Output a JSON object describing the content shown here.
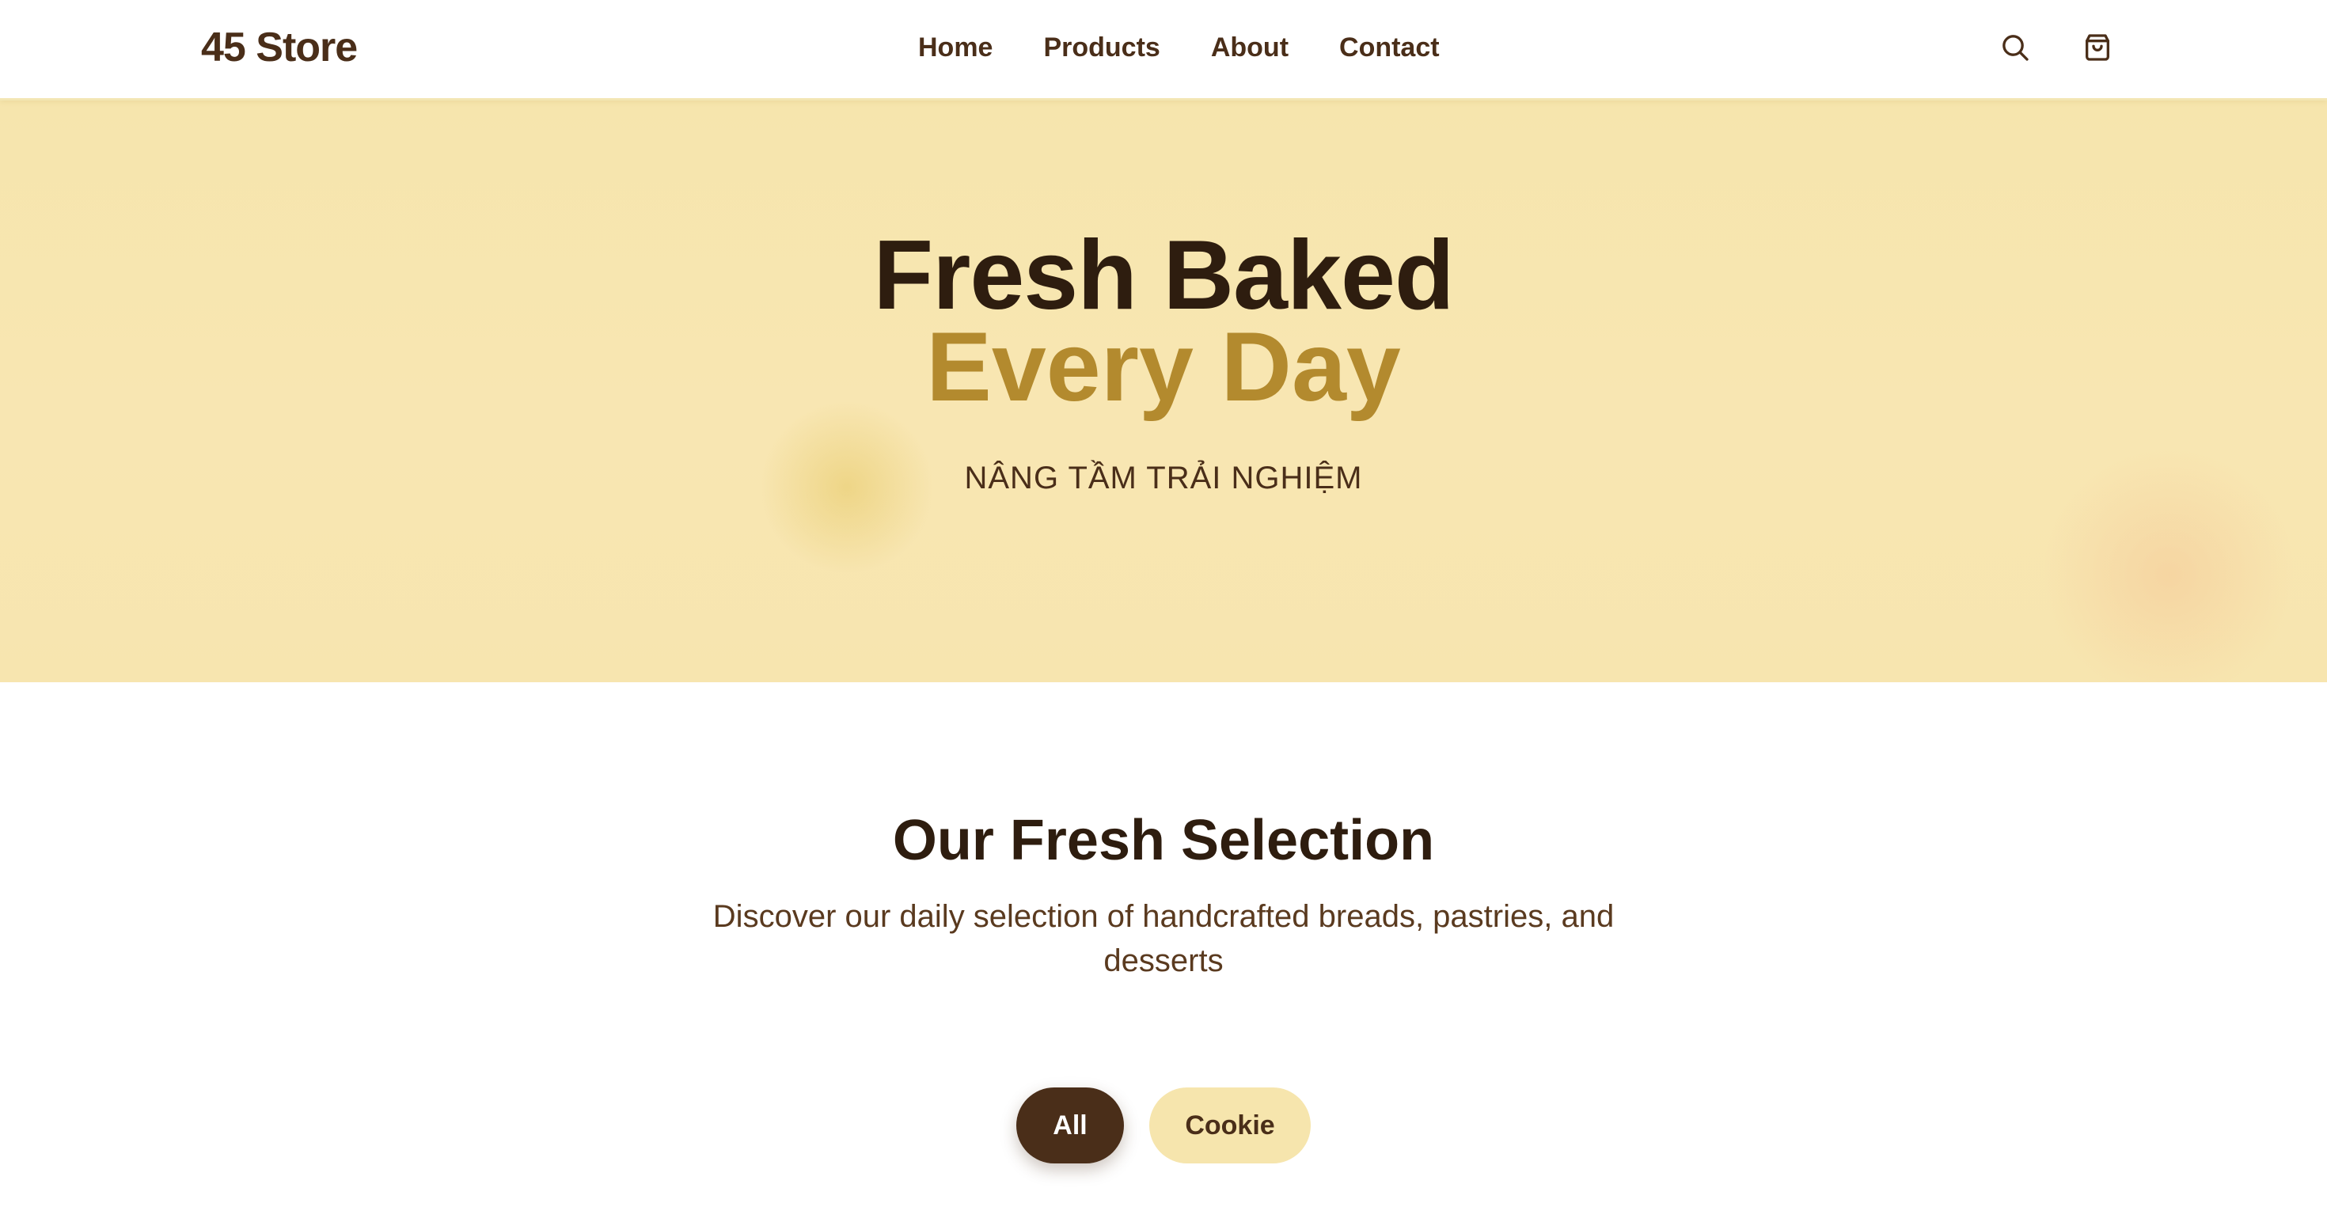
{
  "header": {
    "logo": "45 Store",
    "nav": [
      "Home",
      "Products",
      "About",
      "Contact"
    ],
    "icons": [
      "search-icon",
      "shopping-bag-icon"
    ]
  },
  "hero": {
    "title_line1": "Fresh Baked",
    "title_line2": "Every Day",
    "subtitle": "NÂNG TẦM TRẢI NGHIỆM"
  },
  "section": {
    "title": "Our Fresh Selection",
    "description": "Discover our daily selection of handcrafted breads, pastries, and desserts"
  },
  "filters": {
    "items": [
      "All",
      "Cookie"
    ],
    "active": "All"
  },
  "colors": {
    "primary": "#4a2e19",
    "accent": "#b38a2e",
    "hero_bg": "#f6e5ad"
  }
}
